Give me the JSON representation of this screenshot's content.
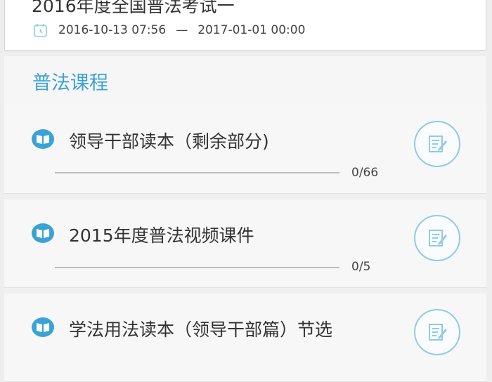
{
  "exam": {
    "title": "2016年度全国普法考试一",
    "start": "2016-10-13 07:56",
    "separator": "—",
    "end": "2017-01-01 00:00",
    "icon": "clock-icon"
  },
  "section": {
    "title": "普法课程"
  },
  "courses": [
    {
      "name": "领导干部读本（剩余部分)",
      "progress": "0/66",
      "progress_fraction": 0
    },
    {
      "name": "2015年度普法视频课件",
      "progress": "0/5",
      "progress_fraction": 0
    },
    {
      "name": "学法用法读本（领导干部篇）节选",
      "progress": "",
      "progress_fraction": 0
    }
  ],
  "icons": {
    "course": "book-icon",
    "action": "edit-note-icon"
  },
  "colors": {
    "accent": "#3aa3d6",
    "accent_light": "#8fcbe8",
    "text": "#333333"
  }
}
